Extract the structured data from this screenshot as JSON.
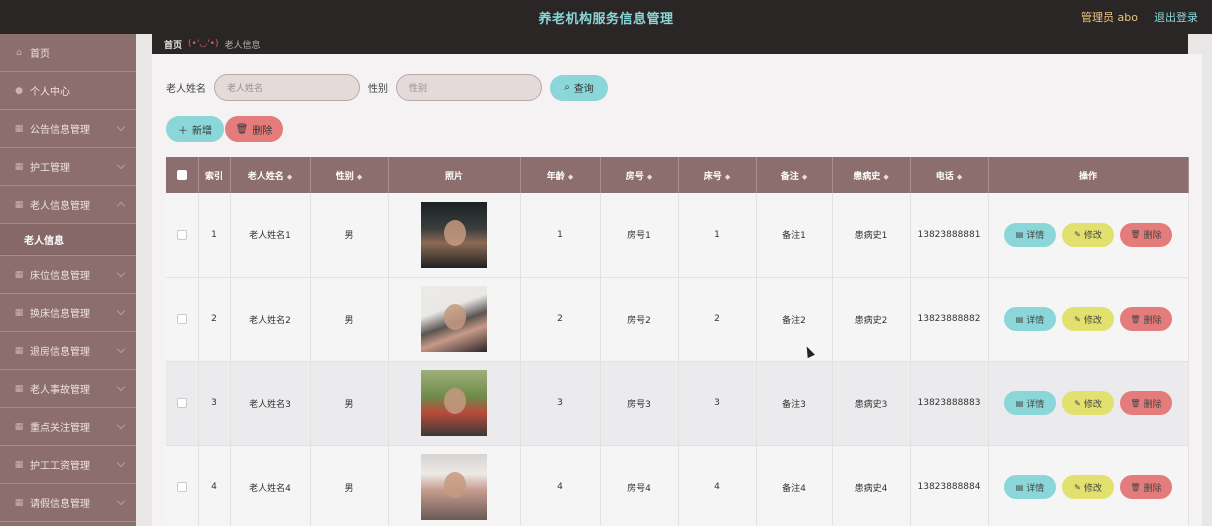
{
  "header": {
    "title": "养老机构服务信息管理",
    "user": "管理员 abo",
    "logout": "退出登录"
  },
  "sidebar": {
    "items": [
      {
        "label": "首页",
        "icon": "home-icon",
        "type": "item"
      },
      {
        "label": "个人中心",
        "icon": "user-icon",
        "type": "item"
      },
      {
        "label": "公告信息管理",
        "icon": "grid-icon",
        "type": "item"
      },
      {
        "label": "护工管理",
        "icon": "grid-icon",
        "type": "item"
      },
      {
        "label": "老人信息管理",
        "icon": "grid-icon",
        "type": "item"
      },
      {
        "label": "老人信息",
        "icon": "",
        "type": "sub"
      },
      {
        "label": "床位信息管理",
        "icon": "grid-icon",
        "type": "item"
      },
      {
        "label": "换床信息管理",
        "icon": "grid-icon",
        "type": "item"
      },
      {
        "label": "退房信息管理",
        "icon": "grid-icon",
        "type": "item"
      },
      {
        "label": "老人事故管理",
        "icon": "grid-icon",
        "type": "item"
      },
      {
        "label": "重点关注管理",
        "icon": "grid-icon",
        "type": "item"
      },
      {
        "label": "护工工资管理",
        "icon": "grid-icon",
        "type": "item"
      },
      {
        "label": "请假信息管理",
        "icon": "grid-icon",
        "type": "item"
      }
    ]
  },
  "breadcrumb": {
    "home": "首页",
    "sep": "(•'◡'•)",
    "current": "老人信息"
  },
  "search": {
    "name_label": "老人姓名",
    "name_placeholder": "老人姓名",
    "gender_label": "性别",
    "gender_placeholder": "性别",
    "button": "查询"
  },
  "actions": {
    "add": "新增",
    "delete": "删除"
  },
  "table": {
    "columns": [
      "索引",
      "老人姓名",
      "性别",
      "照片",
      "年龄",
      "房号",
      "床号",
      "备注",
      "患病史",
      "电话",
      "操作"
    ],
    "row_actions": {
      "detail": "详情",
      "edit": "修改",
      "delete": "删除"
    },
    "rows": [
      {
        "index": "1",
        "name": "老人姓名1",
        "gender": "男",
        "age": "1",
        "room": "房号1",
        "bed": "1",
        "note": "备注1",
        "history": "患病史1",
        "phone": "13823888881"
      },
      {
        "index": "2",
        "name": "老人姓名2",
        "gender": "男",
        "age": "2",
        "room": "房号2",
        "bed": "2",
        "note": "备注2",
        "history": "患病史2",
        "phone": "13823888882"
      },
      {
        "index": "3",
        "name": "老人姓名3",
        "gender": "男",
        "age": "3",
        "room": "房号3",
        "bed": "3",
        "note": "备注3",
        "history": "患病史3",
        "phone": "13823888883"
      },
      {
        "index": "4",
        "name": "老人姓名4",
        "gender": "男",
        "age": "4",
        "room": "房号4",
        "bed": "4",
        "note": "备注4",
        "history": "患病史4",
        "phone": "13823888884"
      }
    ]
  },
  "colors": {
    "topbar": "#2b2626",
    "sidebar": "#8d6e6e",
    "accent_cyan": "#8ad6d8",
    "accent_red": "#e57c7c",
    "accent_yellow": "#e2e06e"
  }
}
